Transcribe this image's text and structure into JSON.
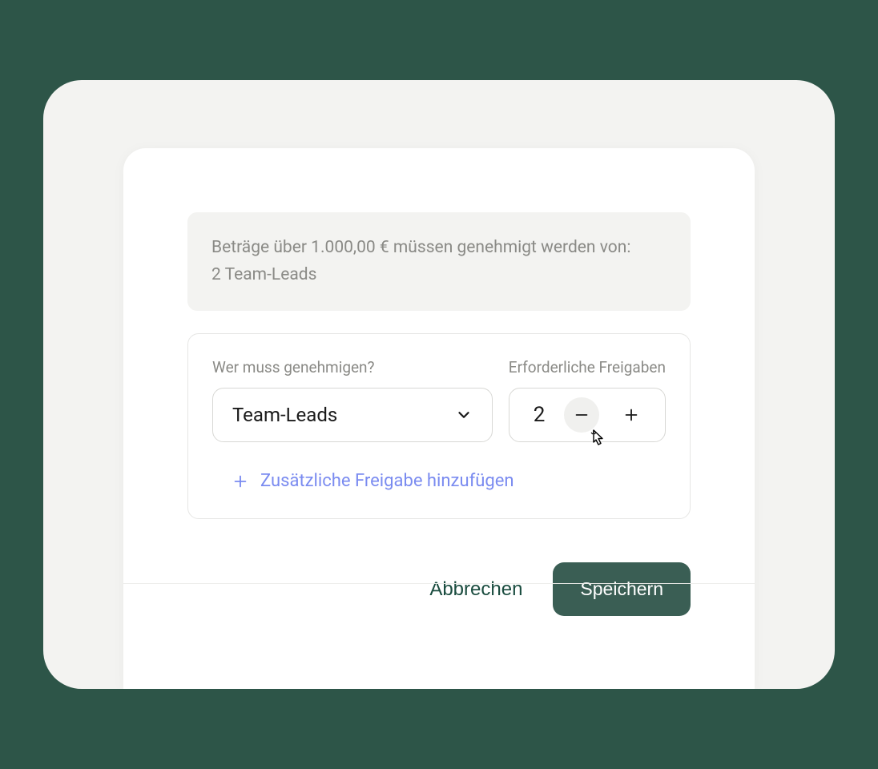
{
  "summary": {
    "line1": "Beträge über 1.000,00 € müssen genehmigt werden von:",
    "line2": "2 Team-Leads"
  },
  "config": {
    "approver_label": "Wer muss genehmigen?",
    "approver_value": "Team-Leads",
    "count_label": "Erforderliche Freigaben",
    "count_value": "2",
    "add_label": "Zusätzliche Freigabe hinzufügen"
  },
  "footer": {
    "cancel": "Abbrechen",
    "save": "Speichern"
  }
}
